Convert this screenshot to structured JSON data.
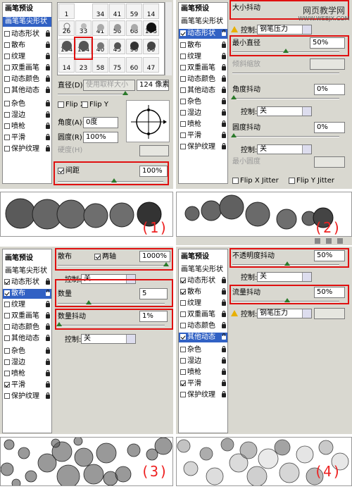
{
  "watermark": {
    "line1": "网页教学网",
    "line2": "WWW.WEBJX.COM"
  },
  "side_items": [
    "画笔笔尖形状",
    "动态形状",
    "散布",
    "纹理",
    "双重画笔",
    "动态颜色",
    "其他动态",
    "杂色",
    "湿边",
    "喷枪",
    "平滑",
    "保护纹理"
  ],
  "side_header": "画笔预设",
  "q1": {
    "brush_numbers_row1": [
      "1",
      "34",
      "41",
      "59",
      "14"
    ],
    "brush_numbers_row2": [
      "26",
      "33",
      "41",
      "56",
      "68",
      "193"
    ],
    "brush_numbers_row3": [
      "134",
      "124",
      "40",
      "45",
      "90",
      "60"
    ],
    "brush_numbers_row4": [
      "14",
      "23",
      "58",
      "75",
      "60",
      "47"
    ],
    "diameter_label": "直径(D)",
    "use_sample_label": "使用取样大小",
    "diameter_value": "124 像素",
    "flipx": "Flip X",
    "flipy": "Flip Y",
    "angle_label": "角度(A):",
    "angle_value": "0度",
    "roundness_label": "圆度(R):",
    "roundness_value": "100%",
    "hardness_label": "硬度(H)",
    "spacing_label": "间距",
    "spacing_value": "100%",
    "badge": "(1)"
  },
  "q2": {
    "size_jitter_label": "大小抖动",
    "control_label": "控制:",
    "control_value": "钢笔压力",
    "min_diameter_label": "最小直径",
    "min_diameter_value": "50%",
    "tilt_scale_label": "倾斜缩放",
    "angle_jitter_label": "角度抖动",
    "angle_jitter_value": "0%",
    "angle_control_value": "关",
    "roundness_jitter_label": "圆度抖动",
    "roundness_jitter_value": "0%",
    "roundness_control_value": "关",
    "min_roundness_label": "最小圆度",
    "flipx_jitter": "Flip X Jitter",
    "flipy_jitter": "Flip Y Jitter",
    "badge": "(2)"
  },
  "q3": {
    "scatter_label": "散布",
    "both_axes_label": "两轴",
    "scatter_value": "1000%",
    "control_label": "控制:",
    "control_value": "关",
    "count_label": "数量",
    "count_value": "5",
    "count_jitter_label": "数量抖动",
    "count_jitter_value": "1%",
    "control2_value": "关",
    "badge": "(3)"
  },
  "q4": {
    "opacity_jitter_label": "不透明度抖动",
    "opacity_jitter_value": "50%",
    "control_label": "控制:",
    "control_value": "关",
    "flow_jitter_label": "流量抖动",
    "flow_jitter_value": "50%",
    "flow_control_value": "钢笔压力",
    "badge": "(4)"
  }
}
